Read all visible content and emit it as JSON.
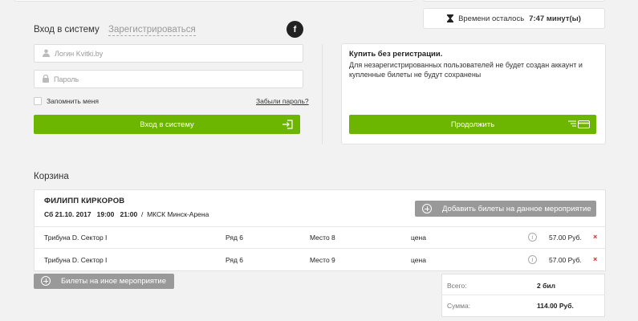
{
  "timer": {
    "label": "Времени осталось",
    "value": "7:47 минут(ы)"
  },
  "auth": {
    "tab_login": "Вход в систему",
    "tab_register": "Зарегистрироваться",
    "social_icon_letter": "f",
    "login_placeholder": "Логин Kvitki.by",
    "password_placeholder": "Пароль",
    "remember_label": "Запомнить меня",
    "forgot_link": "Забыли пароль?",
    "submit_label": "Вход в систему"
  },
  "guest": {
    "title": "Купить без регистрации.",
    "text": "Для незарегистрированных пользователей не будет создан аккаунт и купленные билеты не будут сохранены",
    "continue_label": "Продолжить"
  },
  "cart": {
    "title": "Корзина",
    "event": {
      "name": "ФИЛИПП КИРКОРОВ",
      "day_date": "Сб 21.10. 2017",
      "time_start": "19:00",
      "time_end": "21:00",
      "separator": "/",
      "venue": "МКСК Минск-Арена"
    },
    "add_same_label": "Добавить билеты на данное мероприятие",
    "tickets": [
      {
        "sector": "Трибуна D. Сектор I",
        "row": "Ряд 6",
        "seat": "Место 8",
        "price_label": "цена",
        "info": "i",
        "price": "57.00 Руб.",
        "remove": "×"
      },
      {
        "sector": "Трибуна D. Сектор I",
        "row": "Ряд 6",
        "seat": "Место 9",
        "price_label": "цена",
        "info": "i",
        "price": "57.00 Руб.",
        "remove": "×"
      }
    ],
    "other_event_label": "Билеты на иное мероприятие",
    "summary": {
      "total_label": "Всего:",
      "total_value": "2 бил",
      "sum_label": "Сумма:",
      "sum_value": "114.00 Руб."
    }
  },
  "colors": {
    "accent_green": "#6cb500",
    "button_gray": "#999999",
    "remove_red": "#d62b2b",
    "background": "#f2f2f2"
  },
  "icons": [
    "hourglass-icon",
    "facebook-icon",
    "user-icon",
    "lock-icon",
    "login-arrow-icon",
    "card-icon",
    "plus-circle-icon",
    "info-icon",
    "remove-icon"
  ]
}
